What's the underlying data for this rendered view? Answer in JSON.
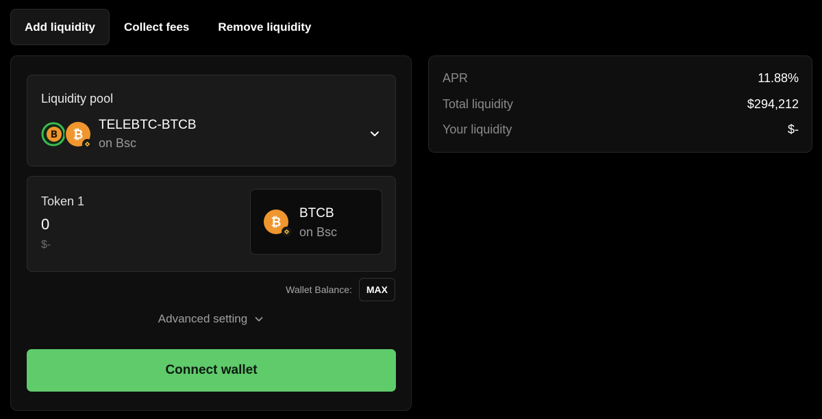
{
  "tabs": [
    {
      "label": "Add liquidity",
      "active": true
    },
    {
      "label": "Collect fees",
      "active": false
    },
    {
      "label": "Remove liquidity",
      "active": false
    }
  ],
  "pool": {
    "label": "Liquidity pool",
    "name": "TELEBTC-BTCB",
    "chain": "on Bsc",
    "icons": [
      "telebtc-coin-icon",
      "btcb-coin-icon",
      "bsc-chain-badge-icon",
      "chevron-down-icon"
    ]
  },
  "token1": {
    "label": "Token 1",
    "amount": "0",
    "usd": "$-",
    "symbol": "BTCB",
    "chain": "on Bsc",
    "icon": "btcb-coin-icon"
  },
  "wallet": {
    "balance_label": "Wallet Balance:",
    "max_label": "MAX"
  },
  "advanced": {
    "label": "Advanced setting",
    "icon": "chevron-down-icon"
  },
  "connect": {
    "label": "Connect wallet"
  },
  "stats": [
    {
      "label": "APR",
      "value": "11.88%"
    },
    {
      "label": "Total liquidity",
      "value": "$294,212"
    },
    {
      "label": "Your liquidity",
      "value": "$-"
    }
  ],
  "colors": {
    "accent_green": "#5fcb6b",
    "bitcoin_orange": "#f0962f",
    "telebtc_green": "#3fb950",
    "background": "#000000",
    "card": "#0f0f0f",
    "panel": "#1a1a1a"
  }
}
